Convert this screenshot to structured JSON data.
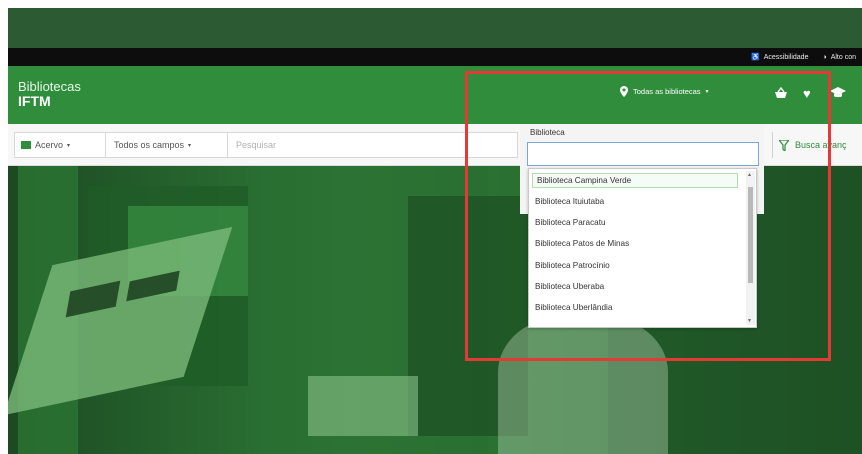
{
  "topbar": {
    "accessibility_label": "Acessibilidade",
    "contrast_label": "Alto con"
  },
  "header": {
    "brand_line1": "Bibliotecas",
    "brand_line2": "IFTM",
    "library_selector_label": "Todas as bibliotecas",
    "icons": [
      "map-marker-icon",
      "basket-icon",
      "heart-icon",
      "graduation-cap-icon"
    ]
  },
  "search": {
    "collection_label": "Acervo",
    "fields_label": "Todos os campos",
    "query_placeholder": "Pesquisar",
    "advanced_label": "Busca avanç"
  },
  "library_dropdown": {
    "label": "Biblioteca",
    "filter_value": "",
    "items": [
      "Biblioteca Campina Verde",
      "Biblioteca Ituiutaba",
      "Biblioteca Paracatu",
      "Biblioteca Patos de Minas",
      "Biblioteca Patrocínio",
      "Biblioteca Uberaba",
      "Biblioteca Uberlândia"
    ],
    "selected_index": 0
  },
  "colors": {
    "header_green": "#2f8d3c",
    "dark_green": "#2c5a32",
    "highlight_red": "#e53935"
  }
}
